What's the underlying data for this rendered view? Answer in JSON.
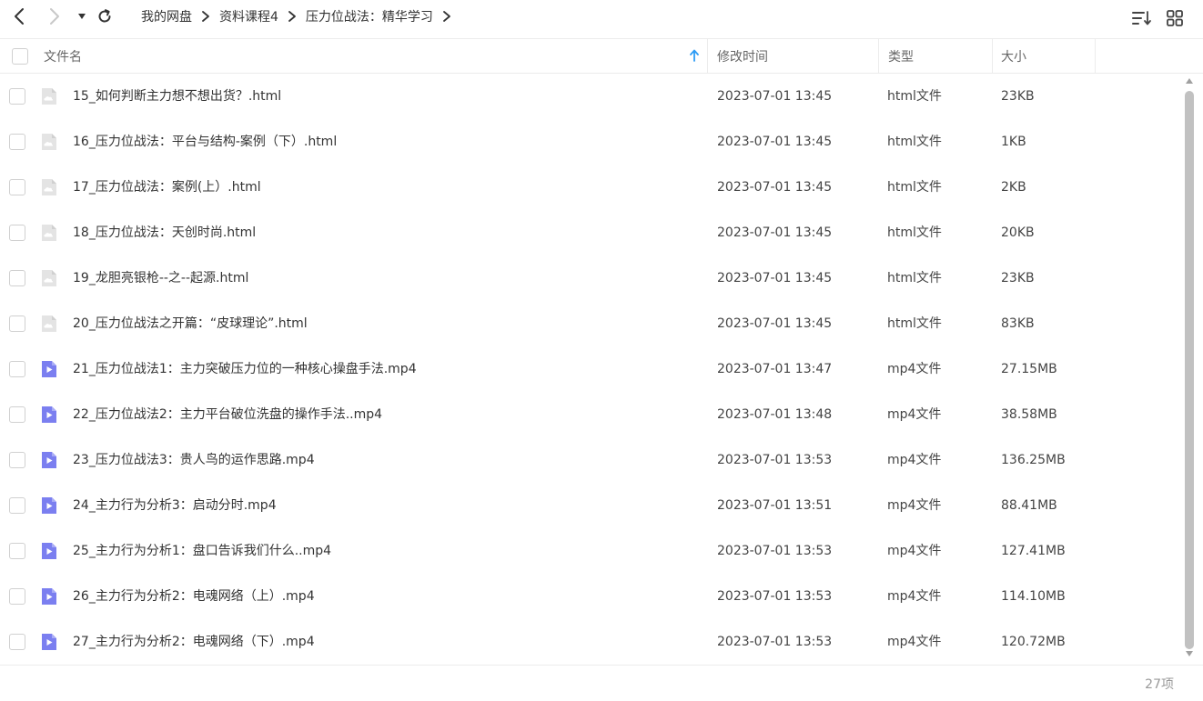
{
  "nav": {
    "breadcrumb": [
      "我的网盘",
      "资料课程4",
      "压力位战法：精华学习"
    ]
  },
  "header": {
    "name": "文件名",
    "modified": "修改时间",
    "type": "类型",
    "size": "大小"
  },
  "files": [
    {
      "name": "15_如何判断主力想不想出货？.html",
      "time": "2023-07-01 13:45",
      "type": "html文件",
      "size": "23KB",
      "icon": "html-file-icon"
    },
    {
      "name": "16_压力位战法：平台与结构-案例（下）.html",
      "time": "2023-07-01 13:45",
      "type": "html文件",
      "size": "1KB",
      "icon": "html-file-icon"
    },
    {
      "name": "17_压力位战法：案例(上）.html",
      "time": "2023-07-01 13:45",
      "type": "html文件",
      "size": "2KB",
      "icon": "html-file-icon"
    },
    {
      "name": "18_压力位战法：天创时尚.html",
      "time": "2023-07-01 13:45",
      "type": "html文件",
      "size": "20KB",
      "icon": "html-file-icon"
    },
    {
      "name": "19_龙胆亮银枪--之--起源.html",
      "time": "2023-07-01 13:45",
      "type": "html文件",
      "size": "23KB",
      "icon": "html-file-icon"
    },
    {
      "name": "20_压力位战法之开篇：“皮球理论”.html",
      "time": "2023-07-01 13:45",
      "type": "html文件",
      "size": "83KB",
      "icon": "html-file-icon"
    },
    {
      "name": "21_压力位战法1：主力突破压力位的一种核心操盘手法.mp4",
      "time": "2023-07-01 13:47",
      "type": "mp4文件",
      "size": "27.15MB",
      "icon": "video-file-icon"
    },
    {
      "name": "22_压力位战法2：主力平台破位洗盘的操作手法..mp4",
      "time": "2023-07-01 13:48",
      "type": "mp4文件",
      "size": "38.58MB",
      "icon": "video-file-icon"
    },
    {
      "name": "23_压力位战法3：贵人鸟的运作思路.mp4",
      "time": "2023-07-01 13:53",
      "type": "mp4文件",
      "size": "136.25MB",
      "icon": "video-file-icon"
    },
    {
      "name": "24_主力行为分析3：启动分时.mp4",
      "time": "2023-07-01 13:51",
      "type": "mp4文件",
      "size": "88.41MB",
      "icon": "video-file-icon"
    },
    {
      "name": "25_主力行为分析1：盘口告诉我们什么..mp4",
      "time": "2023-07-01 13:53",
      "type": "mp4文件",
      "size": "127.41MB",
      "icon": "video-file-icon"
    },
    {
      "name": "26_主力行为分析2：电魂网络（上）.mp4",
      "time": "2023-07-01 13:53",
      "type": "mp4文件",
      "size": "114.10MB",
      "icon": "video-file-icon"
    },
    {
      "name": "27_主力行为分析2：电魂网络（下）.mp4",
      "time": "2023-07-01 13:53",
      "type": "mp4文件",
      "size": "120.72MB",
      "icon": "video-file-icon"
    }
  ],
  "footer": {
    "count": "27项"
  },
  "colors": {
    "accent": "#2d9cf5",
    "video_icon": "#7b7ff0",
    "html_icon": "#d6d6d6"
  }
}
